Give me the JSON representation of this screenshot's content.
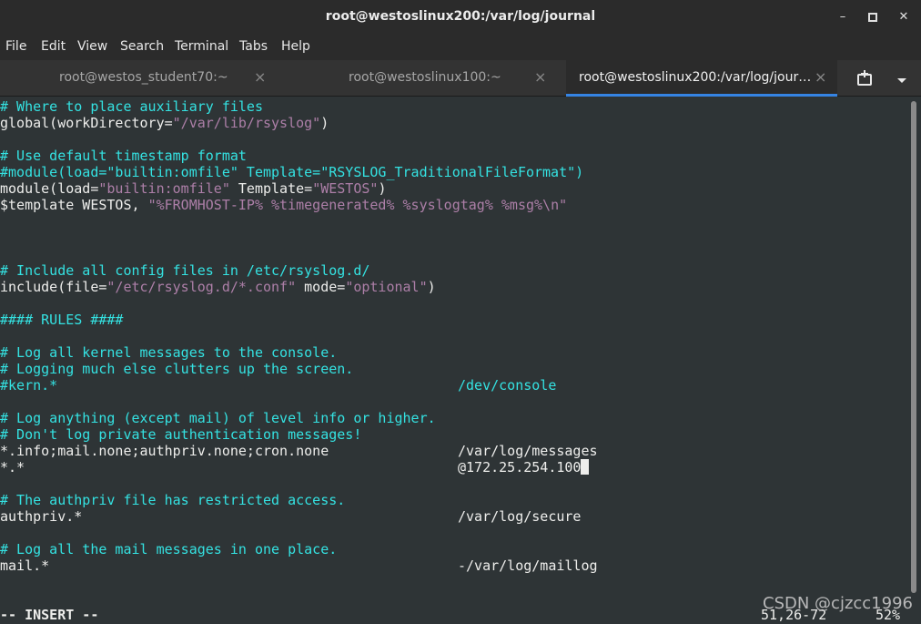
{
  "window": {
    "title": "root@westoslinux200:/var/log/journal",
    "minimize": "–",
    "maximize": "□",
    "close": "✕"
  },
  "menu": [
    "File",
    "Edit",
    "View",
    "Search",
    "Terminal",
    "Tabs",
    "Help"
  ],
  "tabs": [
    {
      "label": "root@westos_student70:~",
      "close": "×",
      "active": false
    },
    {
      "label": "root@westoslinux100:~",
      "close": "×",
      "active": false
    },
    {
      "label": "root@westoslinux200:/var/log/jour…",
      "close": "×",
      "active": true
    }
  ],
  "tabbar": {
    "new_tab_icon": "new-tab-icon",
    "menu_icon": "chevron-down-icon"
  },
  "colors": {
    "accent": "#3584e4",
    "comment": "#34e2e2",
    "string": "#ad7fa8",
    "background": "#2e3436"
  },
  "lines": {
    "l0": {
      "a": "# Where to place auxiliary files"
    },
    "l1": {
      "a": "global(workDirectory=",
      "b": "\"/var/lib/rsyslog\"",
      "c": ")"
    },
    "l3": {
      "a": "# Use default timestamp format"
    },
    "l4": {
      "a": "#module(load=\"builtin:omfile\" Template=\"RSYSLOG_TraditionalFileFormat\")"
    },
    "l5": {
      "a": "module(load=",
      "b": "\"builtin:omfile\"",
      "c": " Template=",
      "d": "\"WESTOS\"",
      "e": ")"
    },
    "l6": {
      "a": "$template WESTOS, ",
      "b": "\"%FROMHOST-IP% %timegenerated% %syslogtag% %msg%\\n\""
    },
    "l10": {
      "a": "# Include all config files in /etc/rsyslog.d/"
    },
    "l11": {
      "a": "include(file=",
      "b": "\"/etc/rsyslog.d/*.conf\"",
      "c": " mode=",
      "d": "\"optional\"",
      "e": ")"
    },
    "l13": {
      "a": "#### RULES ####"
    },
    "l15": {
      "a": "# Log all kernel messages to the console."
    },
    "l16": {
      "a": "# Logging much else clutters up the screen."
    },
    "l17": {
      "a": "#kern.*",
      "b": "/dev/console"
    },
    "l19": {
      "a": "# Log anything (except mail) of level info or higher."
    },
    "l20": {
      "a": "# Don't log private authentication messages!"
    },
    "l21": {
      "a": "*.info;mail.none;authpriv.none;cron.none",
      "b": "/var/log/messages"
    },
    "l22": {
      "a": "*.*",
      "b": "@172.25.254.100"
    },
    "l24": {
      "a": "# The authpriv file has restricted access."
    },
    "l25": {
      "a": "authpriv.*",
      "b": "/var/log/secure"
    },
    "l27": {
      "a": "# Log all the mail messages in one place."
    },
    "l28": {
      "a": "mail.*",
      "b": "-/var/log/maillog"
    }
  },
  "status": {
    "mode": "-- INSERT --",
    "position": "51,26-72",
    "percent": "52%"
  },
  "watermark": "CSDN @cjzcc1996"
}
